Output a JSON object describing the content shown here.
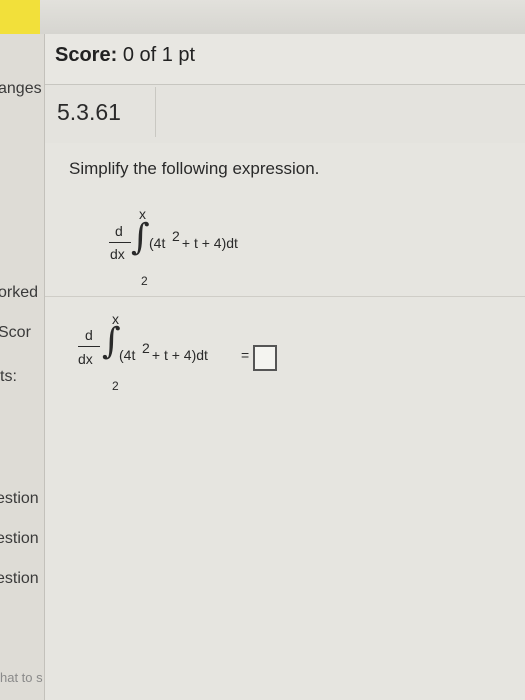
{
  "sidebar": {
    "items": [
      "anges",
      "orked",
      "Scor",
      "ts:",
      "estion",
      "estion",
      "estion",
      "hat to s"
    ]
  },
  "score": {
    "label": "Score:",
    "value": "0 of 1 pt"
  },
  "question": {
    "number": "5.3.61",
    "instruction": "Simplify the following expression.",
    "expression": {
      "d": "d",
      "dx": "dx",
      "upper": "x",
      "lower": "2",
      "integrand_before": "(4t",
      "exponent": "2",
      "integrand_after": " + t + 4)dt"
    },
    "answer": {
      "equals": "=",
      "value": ""
    }
  }
}
